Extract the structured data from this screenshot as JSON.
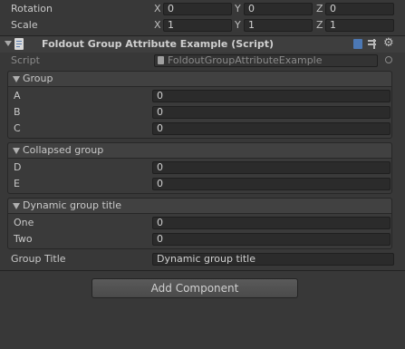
{
  "transform": {
    "rotation_label": "Rotation",
    "scale_label": "Scale",
    "axes": [
      "X",
      "Y",
      "Z"
    ],
    "rotation": [
      "0",
      "0",
      "0"
    ],
    "scale": [
      "1",
      "1",
      "1"
    ]
  },
  "component": {
    "title": "Foldout Group Attribute Example (Script)",
    "script_label": "Script",
    "script_value": "FoldoutGroupAttributeExample"
  },
  "groups": [
    {
      "title": "Group",
      "fields": [
        {
          "label": "A",
          "value": "0"
        },
        {
          "label": "B",
          "value": "0"
        },
        {
          "label": "C",
          "value": "0"
        }
      ]
    },
    {
      "title": "Collapsed group",
      "fields": [
        {
          "label": "D",
          "value": "0"
        },
        {
          "label": "E",
          "value": "0"
        }
      ]
    },
    {
      "title": "Dynamic group title",
      "fields": [
        {
          "label": "One",
          "value": "0"
        },
        {
          "label": "Two",
          "value": "0"
        }
      ]
    }
  ],
  "group_title_field": {
    "label": "Group Title",
    "value": "Dynamic group title"
  },
  "add_component": "Add Component",
  "icons": [
    "script-file-icon",
    "foldout-arrow-icon",
    "help-book-icon",
    "preset-icon",
    "gear-icon",
    "object-picker-icon"
  ]
}
